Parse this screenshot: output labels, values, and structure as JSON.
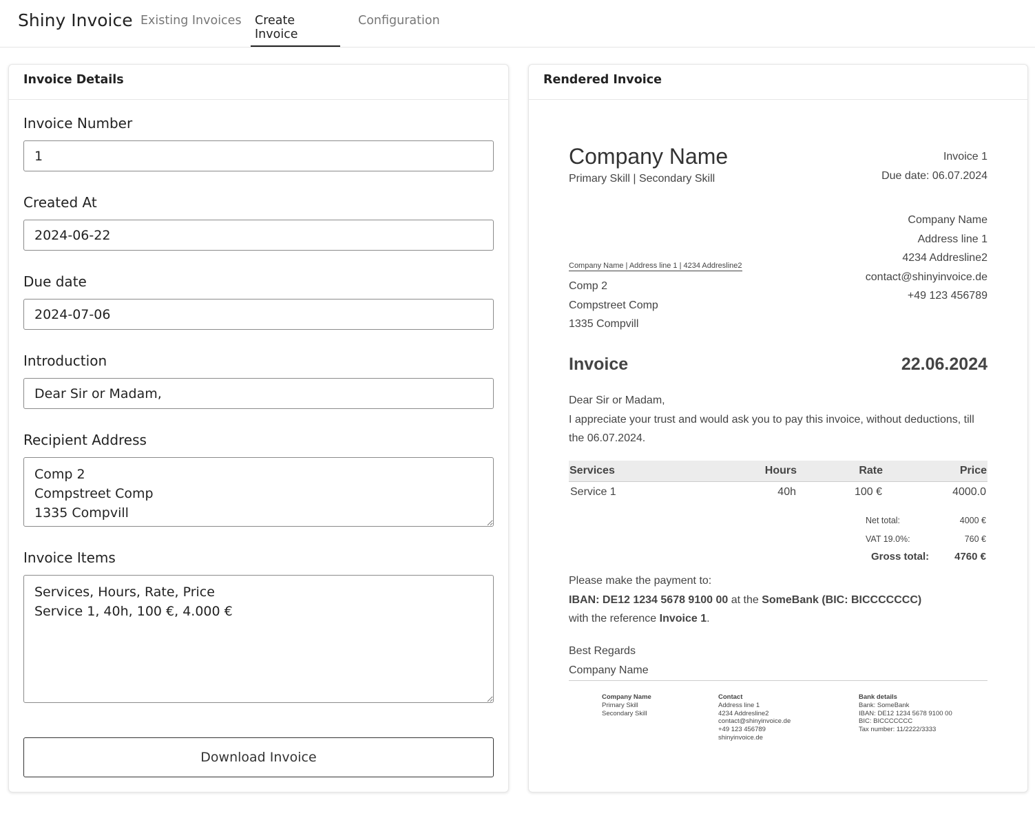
{
  "app": {
    "brand": "Shiny Invoice",
    "tabs": [
      {
        "label": "Existing Invoices",
        "active": false
      },
      {
        "label": "Create Invoice",
        "active": true
      },
      {
        "label": "Configuration",
        "active": false
      }
    ]
  },
  "form": {
    "title": "Invoice Details",
    "invoice_number_label": "Invoice Number",
    "invoice_number": "1",
    "created_at_label": "Created At",
    "created_at": "2024-06-22",
    "due_date_label": "Due date",
    "due_date": "2024-07-06",
    "introduction_label": "Introduction",
    "introduction": "Dear Sir or Madam,",
    "recipient_label": "Recipient Address",
    "recipient": "Comp 2\nCompstreet Comp\n1335 Compvill",
    "items_label": "Invoice Items",
    "items": "Services, Hours, Rate, Price\nService 1, 40h, 100 €, 4.000 €",
    "download_label": "Download Invoice"
  },
  "preview": {
    "title": "Rendered Invoice",
    "company_name": "Company Name",
    "skills": "Primary Skill | Secondary Skill",
    "invoice_ref": "Invoice 1",
    "due_line": "Due date: 06.07.2024",
    "sender_address": [
      "Company Name",
      "Address line 1",
      "4234 Addresline2",
      "contact@shinyinvoice.de",
      "+49 123 456789"
    ],
    "sender_line": "Company Name | Address line 1 | 4234 Addresline2",
    "recipient_lines": [
      "Comp 2",
      "Compstreet Comp",
      "1335 Compvill"
    ],
    "heading": "Invoice",
    "date": "22.06.2024",
    "greeting": "Dear Sir or Madam,",
    "body": "I appreciate your trust and would ask you to pay this invoice, without deductions, till the 06.07.2024.",
    "table_headers": [
      "Services",
      "Hours",
      "Rate",
      "Price"
    ],
    "table_rows": [
      [
        "Service 1",
        "40h",
        "100 €",
        "4000.0"
      ]
    ],
    "net_label": "Net total:",
    "net_value": "4000 €",
    "vat_label": "VAT 19.0%:",
    "vat_value": "760 €",
    "gross_label": "Gross total:",
    "gross_value": "4760 €",
    "payment_intro": "Please make the payment to:",
    "iban": "IBAN: DE12 1234 5678 9100 00",
    "at_the": " at the ",
    "bank": "SomeBank (BIC: BICCCCCCC)",
    "reference_prefix": "with the reference ",
    "reference": "Invoice 1",
    "reference_suffix": ".",
    "regards": "Best Regards",
    "signature": "Company Name",
    "footer": {
      "col1": {
        "heading": "Company Name",
        "lines": [
          "Primary Skill",
          "Secondary Skill"
        ]
      },
      "col2": {
        "heading": "Contact",
        "lines": [
          "Address line 1",
          "4234 Addresline2",
          "contact@shinyinvoice.de",
          "+49 123 456789",
          "shinyinvoice.de"
        ]
      },
      "col3": {
        "heading": "Bank details",
        "lines": [
          "Bank: SomeBank",
          "IBAN: DE12 1234 5678 9100 00",
          "BIC: BICCCCCCC",
          "Tax number: 11/2222/3333"
        ]
      }
    }
  }
}
